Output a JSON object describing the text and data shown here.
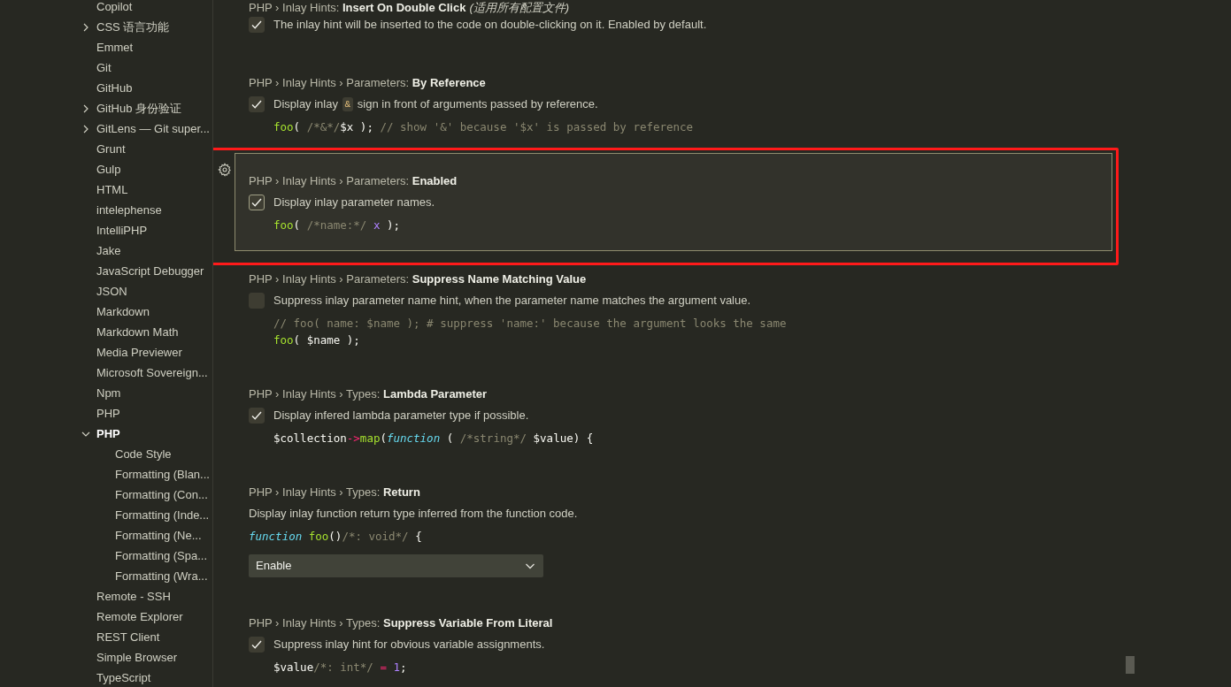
{
  "sidebar": {
    "items": [
      {
        "label": "Copilot",
        "kind": "leaf",
        "selected": false
      },
      {
        "label": "CSS 语言功能",
        "kind": "group",
        "expanded": false,
        "selected": false
      },
      {
        "label": "Emmet",
        "kind": "leaf",
        "selected": false
      },
      {
        "label": "Git",
        "kind": "leaf",
        "selected": false
      },
      {
        "label": "GitHub",
        "kind": "leaf",
        "selected": false
      },
      {
        "label": "GitHub 身份验证",
        "kind": "group",
        "expanded": false,
        "selected": false
      },
      {
        "label": "GitLens — Git super...",
        "kind": "group",
        "expanded": false,
        "selected": false
      },
      {
        "label": "Grunt",
        "kind": "leaf",
        "selected": false
      },
      {
        "label": "Gulp",
        "kind": "leaf",
        "selected": false
      },
      {
        "label": "HTML",
        "kind": "leaf",
        "selected": false
      },
      {
        "label": "intelephense",
        "kind": "leaf",
        "selected": false
      },
      {
        "label": "IntelliPHP",
        "kind": "leaf",
        "selected": false
      },
      {
        "label": "Jake",
        "kind": "leaf",
        "selected": false
      },
      {
        "label": "JavaScript Debugger",
        "kind": "leaf",
        "selected": false
      },
      {
        "label": "JSON",
        "kind": "leaf",
        "selected": false
      },
      {
        "label": "Markdown",
        "kind": "leaf",
        "selected": false
      },
      {
        "label": "Markdown Math",
        "kind": "leaf",
        "selected": false
      },
      {
        "label": "Media Previewer",
        "kind": "leaf",
        "selected": false
      },
      {
        "label": "Microsoft Sovereign...",
        "kind": "leaf",
        "selected": false
      },
      {
        "label": "Npm",
        "kind": "leaf",
        "selected": false
      },
      {
        "label": "PHP",
        "kind": "leaf",
        "selected": false
      },
      {
        "label": "PHP",
        "kind": "group",
        "expanded": true,
        "selected": true,
        "children": [
          {
            "label": "Code Style",
            "selected": false
          },
          {
            "label": "Formatting (Blan...",
            "selected": false
          },
          {
            "label": "Formatting (Con...",
            "selected": false
          },
          {
            "label": "Formatting (Inde...",
            "selected": false
          },
          {
            "label": "Formatting (Ne...",
            "selected": false
          },
          {
            "label": "Formatting (Spa...",
            "selected": false
          },
          {
            "label": "Formatting (Wra...",
            "selected": false
          }
        ]
      },
      {
        "label": "Remote - SSH",
        "kind": "leaf",
        "selected": false
      },
      {
        "label": "Remote Explorer",
        "kind": "leaf",
        "selected": false
      },
      {
        "label": "REST Client",
        "kind": "leaf",
        "selected": false
      },
      {
        "label": "Simple Browser",
        "kind": "leaf",
        "selected": false
      },
      {
        "label": "TypeScript",
        "kind": "leaf",
        "selected": false
      }
    ]
  },
  "settings": [
    {
      "kind": "checkbox",
      "category": "PHP › Inlay Hints: ",
      "name": "Insert On Double Click",
      "scope": "(适用所有配置文件)",
      "checked": true,
      "focused": false,
      "description": "The inlay hint will be inserted to the code on double-clicking on it. Enabled by default."
    },
    {
      "kind": "checkbox",
      "category": "PHP › Inlay Hints › Parameters: ",
      "name": "By Reference",
      "checked": true,
      "focused": false,
      "description": [
        {
          "kind": "text",
          "text": "Display inlay "
        },
        {
          "kind": "code",
          "text": "&"
        },
        {
          "kind": "text",
          "text": " sign in front of arguments passed by reference."
        }
      ],
      "code": [
        [
          {
            "kind": "function",
            "text": "foo"
          },
          {
            "kind": "plain",
            "text": "( "
          },
          {
            "kind": "comment",
            "text": "/*&*/"
          },
          {
            "kind": "plain",
            "text": "$x ); "
          },
          {
            "kind": "comment",
            "text": "// show '&' because '$x' is passed by reference"
          }
        ]
      ]
    },
    {
      "kind": "checkbox",
      "category": "PHP › Inlay Hints › Parameters: ",
      "name": "Enabled",
      "checked": true,
      "focused": true,
      "description": "Display inlay parameter names.",
      "code": [
        [
          {
            "kind": "function",
            "text": "foo"
          },
          {
            "kind": "plain",
            "text": "( "
          },
          {
            "kind": "comment",
            "text": "/*name:*/ "
          },
          {
            "kind": "constant",
            "text": "x"
          },
          {
            "kind": "plain",
            "text": " );"
          }
        ]
      ]
    },
    {
      "kind": "checkbox",
      "category": "PHP › Inlay Hints › Parameters: ",
      "name": "Suppress Name Matching Value",
      "checked": false,
      "focused": false,
      "description": "Suppress inlay parameter name hint, when the parameter name matches the argument value.",
      "code": [
        [
          {
            "kind": "comment",
            "text": "// foo( name: $name ); # suppress 'name:' because the argument looks the same"
          }
        ],
        [
          {
            "kind": "function",
            "text": "foo"
          },
          {
            "kind": "plain",
            "text": "( $name );"
          }
        ]
      ]
    },
    {
      "kind": "checkbox",
      "category": "PHP › Inlay Hints › Types: ",
      "name": "Lambda Parameter",
      "checked": true,
      "focused": false,
      "description": "Display infered lambda parameter type if possible.",
      "code": [
        [
          {
            "kind": "plain",
            "text": "$collection"
          },
          {
            "kind": "operator",
            "text": "->"
          },
          {
            "kind": "function",
            "text": "map"
          },
          {
            "kind": "plain",
            "text": "("
          },
          {
            "kind": "keyword",
            "text": "function"
          },
          {
            "kind": "plain",
            "text": " ( "
          },
          {
            "kind": "comment",
            "text": "/*string*/"
          },
          {
            "kind": "plain",
            "text": " $value) {"
          }
        ]
      ]
    },
    {
      "kind": "dropdown",
      "category": "PHP › Inlay Hints › Types: ",
      "name": "Return",
      "value": "Enable",
      "focused": false,
      "description": "Display inlay function return type inferred from the function code.",
      "code": [
        [
          {
            "kind": "keyword",
            "text": "function"
          },
          {
            "kind": "function",
            "text": " foo"
          },
          {
            "kind": "plain",
            "text": "()"
          },
          {
            "kind": "comment",
            "text": "/*: void*/"
          },
          {
            "kind": "plain",
            "text": " {"
          }
        ]
      ]
    },
    {
      "kind": "checkbox",
      "category": "PHP › Inlay Hints › Types: ",
      "name": "Suppress Variable From Literal",
      "checked": true,
      "focused": false,
      "description": "Suppress inlay hint for obvious variable assignments.",
      "code": [
        [
          {
            "kind": "plain",
            "text": "$value"
          },
          {
            "kind": "comment",
            "text": "/*: int*/ "
          },
          {
            "kind": "operator",
            "text": "= "
          },
          {
            "kind": "constant",
            "text": "1"
          },
          {
            "kind": "plain",
            "text": ";"
          }
        ]
      ]
    }
  ]
}
